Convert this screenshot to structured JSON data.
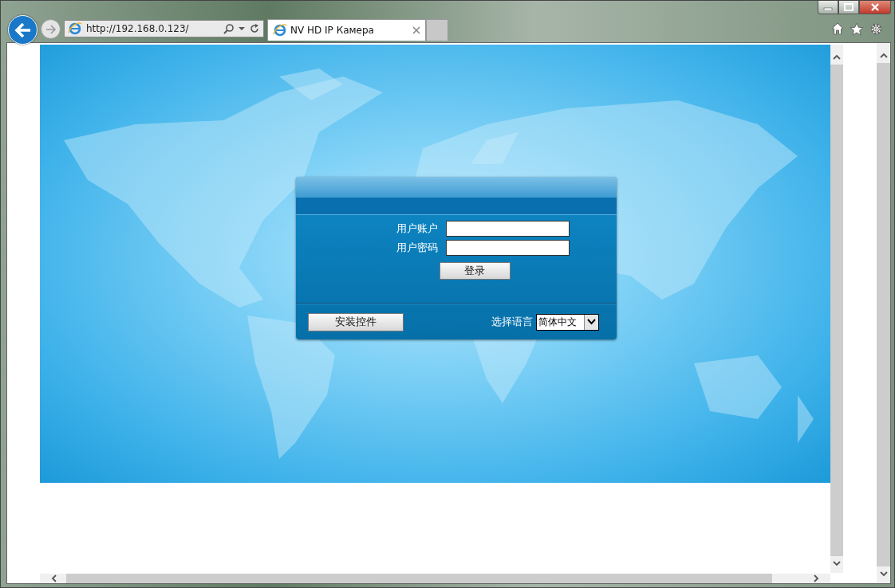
{
  "browser": {
    "address": "http://192.168.0.123/",
    "tabs": [
      {
        "title": "NV HD IP Камера",
        "selected": true
      }
    ]
  },
  "login": {
    "fields": [
      {
        "label": "用户账户"
      },
      {
        "label": "用户密码"
      }
    ],
    "login_button": "登录",
    "install_button": "安装控件",
    "language_label": "选择语言",
    "language_value": "简体中文"
  }
}
